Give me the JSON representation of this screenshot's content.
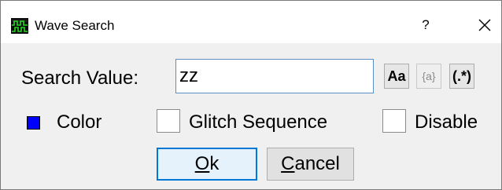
{
  "window": {
    "title": "Wave Search",
    "help_label": "?",
    "app_icon": "waveform-app-icon",
    "close_icon": "close-icon"
  },
  "search": {
    "label": "Search Value:",
    "value": "zz",
    "toggles": [
      {
        "name": "match-case",
        "label": "Aa",
        "enabled": true
      },
      {
        "name": "whole-word",
        "label": "{a}",
        "enabled": false
      },
      {
        "name": "regex",
        "label": "(.*)",
        "enabled": true
      }
    ]
  },
  "options": {
    "color_label": "Color",
    "color_value": "#0000ff",
    "glitch_label": "Glitch Sequence",
    "glitch_checked": false,
    "disable_label": "Disable",
    "disable_checked": false
  },
  "buttons": {
    "ok_mnemonic": "O",
    "ok_rest": "k",
    "cancel_mnemonic": "C",
    "cancel_rest": "ancel"
  }
}
